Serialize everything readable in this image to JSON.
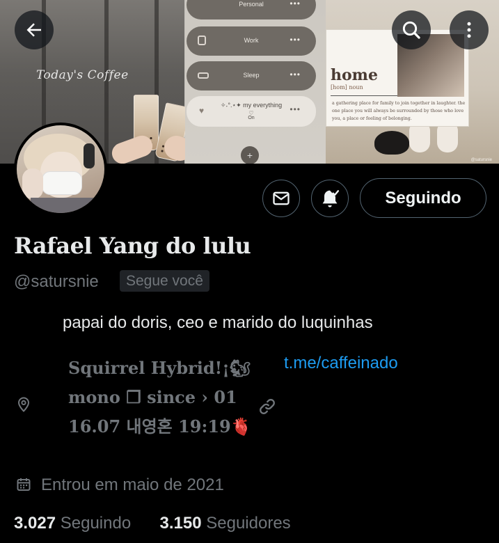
{
  "banner": {
    "cafe_sign": "Today's Coffee",
    "settings_pills": [
      "Personal",
      "Work",
      "Sleep"
    ],
    "focus_pill": {
      "label": "✧˖°.⋆✦ my everything",
      "state": "On"
    },
    "home_card": {
      "word": "home",
      "pronunciation": "[hom] noun",
      "definition": "a gathering place for family to join together in laughter. the one place you will always be surrounded by those who love you, a place or feeling of belonging."
    },
    "watermark": "@satursnie"
  },
  "header": {
    "back_icon": "arrow-left-icon",
    "search_icon": "search-icon",
    "more_icon": "more-vertical-icon"
  },
  "actions": {
    "message_icon": "mail-icon",
    "notify_icon": "bell-check-icon",
    "follow_label": "Seguindo"
  },
  "profile": {
    "display_name": "Rafael Yang do lulu",
    "handle": "@satursnie",
    "follows_you": "Segue você",
    "bio": "papai do doris, ceo e marido do luquinhas",
    "location_lines": [
      "Squirrel Hybrid!¡🐿",
      "mono ❒ since › 01",
      "16.07 내영혼 19:19🫀"
    ],
    "link": "t.me/caffeinado",
    "joined": "Entrou em maio de 2021"
  },
  "stats": {
    "following_count": "3.027",
    "following_label": "Seguindo",
    "followers_count": "3.150",
    "followers_label": "Seguidores"
  },
  "colors": {
    "background": "#000000",
    "text_primary": "#e7e9ea",
    "text_secondary": "#71767b",
    "link": "#1d9bf0",
    "border": "#536471"
  }
}
